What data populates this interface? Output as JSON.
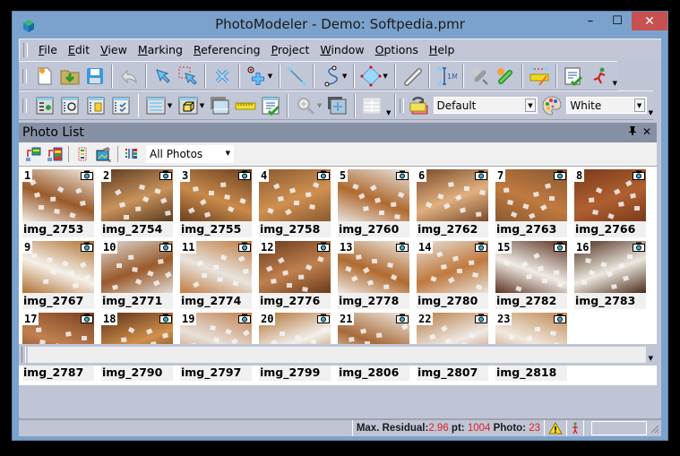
{
  "window": {
    "title": "PhotoModeler - Demo: Softpedia.pmr",
    "minimize_icon": "minimize-icon",
    "maximize_icon": "maximize-icon",
    "close_icon": "close-icon",
    "close_glyph": "✕",
    "minimize_glyph": "–",
    "maximize_glyph": "☐"
  },
  "menubar": {
    "items": [
      {
        "accel": "F",
        "rest": "ile"
      },
      {
        "accel": "E",
        "rest": "dit"
      },
      {
        "accel": "V",
        "rest": "iew"
      },
      {
        "accel": "M",
        "rest": "arking"
      },
      {
        "accel": "R",
        "rest": "eferencing"
      },
      {
        "accel": "P",
        "rest": "roject"
      },
      {
        "accel": "W",
        "rest": "indow"
      },
      {
        "accel": "O",
        "rest": "ptions"
      },
      {
        "accel": "H",
        "rest": "elp"
      }
    ]
  },
  "toolbar1": {
    "buttons": [
      "new-project",
      "open-project",
      "save-project",
      "undo",
      "select-mode",
      "multi-select",
      "delete",
      "add-point",
      "line",
      "curve",
      "surface",
      "measure-tape",
      "scale-rotate",
      "reference-mode",
      "auto-reference",
      "scale-ruler",
      "project-status",
      "run-processing"
    ]
  },
  "toolbar2": {
    "buttons": [
      "photo-table",
      "open-photo",
      "photo-sets",
      "check-quality",
      "table-view",
      "3d-view",
      "photo-view",
      "scale-ruler",
      "quality-report",
      "zoom",
      "tile-windows",
      "layout-grid",
      "layers",
      "palette"
    ],
    "layer_combo_value": "Default",
    "color_combo_value": "White"
  },
  "photo_list": {
    "title": "Photo List",
    "pin_glyph": "⊥",
    "close_glyph": "✕",
    "filter_value": "All Photos",
    "photos": [
      {
        "n": "1",
        "name": "img_2753",
        "c1": "#f2ede6",
        "c2": "#9a5a2a"
      },
      {
        "n": "2",
        "name": "img_2754",
        "c1": "#5a3a20",
        "c2": "#c9925a"
      },
      {
        "n": "3",
        "name": "img_2755",
        "c1": "#6a4020",
        "c2": "#c98a4a"
      },
      {
        "n": "4",
        "name": "img_2758",
        "c1": "#8a5a30",
        "c2": "#d09050"
      },
      {
        "n": "5",
        "name": "img_2760",
        "c1": "#e8e4e0",
        "c2": "#b06a30"
      },
      {
        "n": "6",
        "name": "img_2762",
        "c1": "#7a4a2a",
        "c2": "#e0b080"
      },
      {
        "n": "7",
        "name": "img_2763",
        "c1": "#8a5a30",
        "c2": "#c07a40"
      },
      {
        "n": "8",
        "name": "img_2766",
        "c1": "#7a3a1a",
        "c2": "#b06030"
      },
      {
        "n": "9",
        "name": "img_2767",
        "c1": "#b07030",
        "c2": "#f5f0ea"
      },
      {
        "n": "10",
        "name": "img_2771",
        "c1": "#e0dcd6",
        "c2": "#9a5a2a"
      },
      {
        "n": "11",
        "name": "img_2774",
        "c1": "#c07a40",
        "c2": "#e8e4de"
      },
      {
        "n": "12",
        "name": "img_2776",
        "c1": "#6a3a1a",
        "c2": "#c08050"
      },
      {
        "n": "13",
        "name": "img_2778",
        "c1": "#eeeae4",
        "c2": "#b06a30"
      },
      {
        "n": "14",
        "name": "img_2780",
        "c1": "#e8e2da",
        "c2": "#c07a40"
      },
      {
        "n": "15",
        "name": "img_2782",
        "c1": "#5a3020",
        "c2": "#f0ece6"
      },
      {
        "n": "16",
        "name": "img_2783",
        "c1": "#4a2a18",
        "c2": "#ece8e0"
      },
      {
        "n": "17",
        "name": "img_2787",
        "c1": "#7a4020",
        "c2": "#c08050"
      },
      {
        "n": "18",
        "name": "img_2790",
        "c1": "#5a3018",
        "c2": "#d0904a"
      },
      {
        "n": "19",
        "name": "img_2797",
        "c1": "#c08050",
        "c2": "#e8e0d8"
      },
      {
        "n": "20",
        "name": "img_2799",
        "c1": "#b07030",
        "c2": "#f2f0ec"
      },
      {
        "n": "21",
        "name": "img_2806",
        "c1": "#f0ece8",
        "c2": "#a86a38"
      },
      {
        "n": "22",
        "name": "img_2807",
        "c1": "#b87a40",
        "c2": "#eeeae6"
      },
      {
        "n": "23",
        "name": "img_2818",
        "c1": "#c08850",
        "c2": "#f0e8de"
      }
    ]
  },
  "statusbar": {
    "max_residual_label": "Max. Residual:",
    "max_residual_value": "2.96",
    "pt_label": " pt: ",
    "pt_value": "1004",
    "photo_label": " Photo: ",
    "photo_value": "23",
    "value_color": "#e02020"
  }
}
